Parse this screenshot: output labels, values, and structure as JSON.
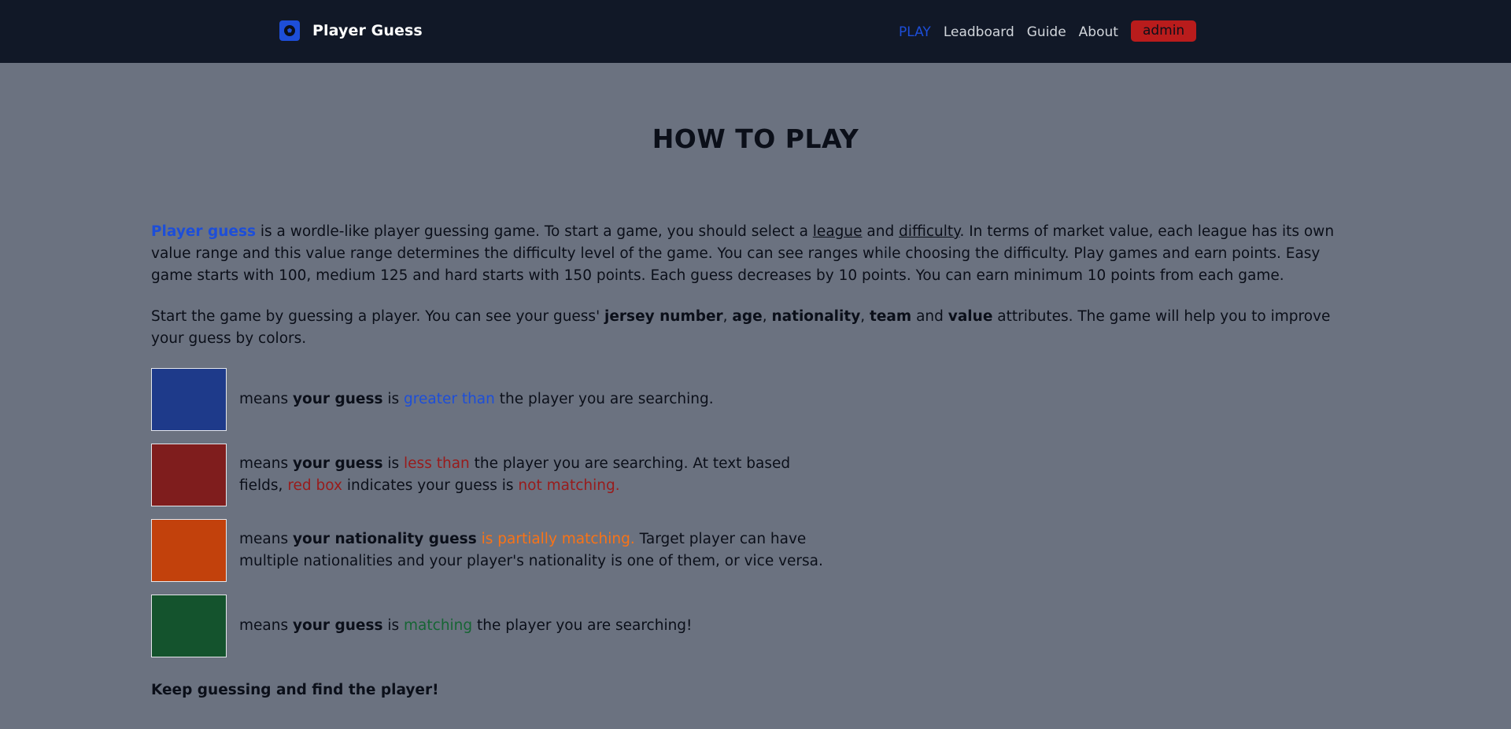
{
  "nav": {
    "brand": "Player Guess",
    "links": [
      "PLAY",
      "Leadboard",
      "Guide",
      "About"
    ],
    "user": "admin"
  },
  "page": {
    "title": "HOW TO PLAY"
  },
  "intro": {
    "brand_word": "Player guess",
    "text_1": " is a wordle-like player guessing game. To start a game, you should select a ",
    "league": "league",
    "and": " and ",
    "difficulty": "difficulty",
    "text_2": ". In terms of market value, each league has its own value range and this value range determines the difficulty level of the game. You can see ranges while choosing the difficulty. Play games and earn points. Easy game starts with 100, medium 125 and hard starts with 150 points. Each guess decreases by 10 points. You can earn minimum 10 points from each game."
  },
  "attributes": {
    "text_1": "Start the game by guessing a player. You can see your guess' ",
    "a1": "jersey number",
    "c1": ", ",
    "a2": "age",
    "c2": ", ",
    "a3": "nationality",
    "c3": ", ",
    "a4": "team",
    "c4": " and ",
    "a5": "value",
    "text_2": " attributes. The game will help you to improve your guess by colors."
  },
  "legend": [
    {
      "color": "#1e3a8a",
      "means": "means ",
      "subject": "your guess",
      "is": " is ",
      "highlight": "greater than",
      "rest": " the player you are searching."
    },
    {
      "color": "#7f1d1d",
      "means": "means ",
      "subject": "your guess",
      "is": " is ",
      "highlight": "less than",
      "rest": " the player you are searching. At text based fields, ",
      "highlight_2": "red box",
      "rest_2": " indicates your guess is ",
      "highlight_3": "not matching."
    },
    {
      "color": "#c2410c",
      "means": "means ",
      "subject": "your nationality guess",
      "is": " ",
      "highlight": "is partially matching.",
      "rest": " Target player can have multiple nationalities and your player's nationality is one of them, or vice versa."
    },
    {
      "color": "#14532d",
      "means": "means ",
      "subject": "your guess",
      "is": " is ",
      "highlight": "matching",
      "rest": " the player you are searching!"
    }
  ],
  "footer": {
    "note": "Keep guessing and find the player!"
  },
  "colors": {
    "navbar": "#111827",
    "page_bg": "#6b7280",
    "accent_blue": "#1d4ed8",
    "admin_red": "#b91c1c"
  }
}
